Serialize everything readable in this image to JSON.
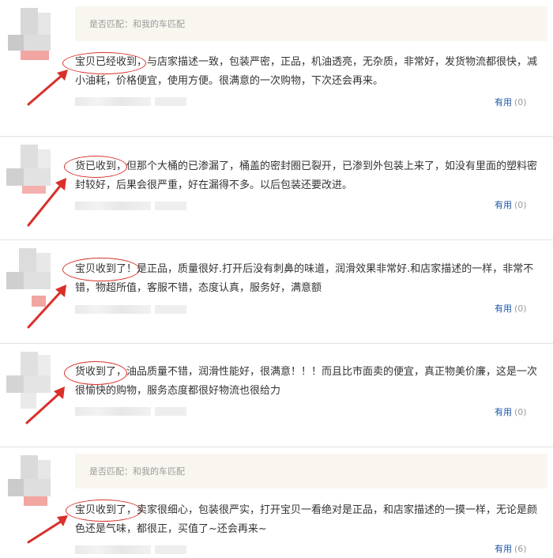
{
  "reviews": [
    {
      "match": "是否匹配：和我的车匹配",
      "text": "宝贝已经收到，与店家描述一致，包装严密，正品，机油透亮，无杂质，非常好，发货物流都很快，减小油耗，价格便宜，使用方便。很满意的一次购物，下次还会再来。",
      "useful_label": "有用",
      "useful_count": "(0)"
    },
    {
      "match": "",
      "text": "货已收到，但那个大桶的已渗漏了，桶盖的密封圈已裂开，已渗到外包装上来了，如没有里面的塑料密封较好，后果会很严重，好在漏得不多。以后包装还要改进。",
      "useful_label": "有用",
      "useful_count": "(0)"
    },
    {
      "match": "",
      "text": "宝贝收到了！是正品，质量很好.打开后没有刺鼻的味道，润滑效果非常好.和店家描述的一样，非常不错，物超所值，客服不错，态度认真，服务好，满意额",
      "useful_label": "有用",
      "useful_count": "(0)"
    },
    {
      "match": "",
      "text": "货收到了，油品质量不错，润滑性能好，很满意！！！而且比市面卖的便宜，真正物美价廉，这是一次很愉快的购物，服务态度都很好物流也很给力",
      "useful_label": "有用",
      "useful_count": "(0)"
    },
    {
      "match": "是否匹配：和我的车匹配",
      "text": "宝贝收到了，卖家很细心，包装很严实，打开宝贝一看绝对是正品，和店家描述的一摸一样，无论是颜色还是气味，都很正，买值了~还会再来~",
      "useful_label": "有用",
      "useful_count": "(6)"
    }
  ],
  "colors": {
    "accent": "#d9302a",
    "link": "#1a55a8",
    "match_bg": "#f9f6f0"
  }
}
